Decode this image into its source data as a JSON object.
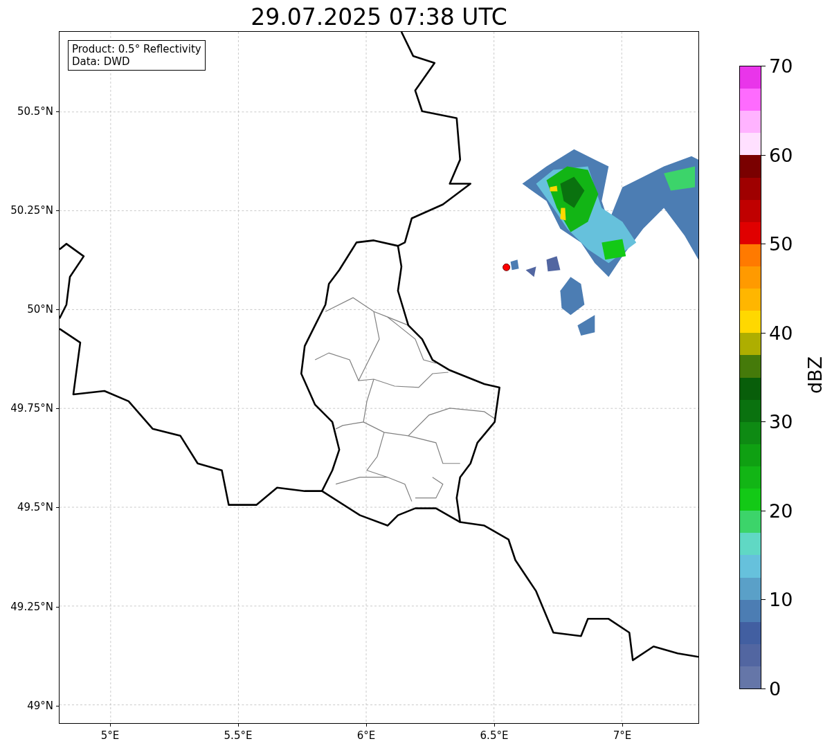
{
  "title": "29.07.2025 07:38 UTC",
  "legend": [
    "Product: 0.5° Reflectivity",
    "Data: DWD"
  ],
  "map": {
    "y_ticks": [
      "50.5°N",
      "50.25°N",
      "50°N",
      "49.75°N",
      "49.5°N",
      "49.25°N",
      "49°N"
    ],
    "x_ticks": [
      "5°E",
      "5.5°E",
      "6°E",
      "6.5°E",
      "7°E"
    ]
  },
  "colorbar": {
    "label": "dBZ",
    "ticks": [
      "70",
      "60",
      "50",
      "40",
      "30",
      "20",
      "10",
      "0"
    ],
    "bins": [
      {
        "color": "#e935ea"
      },
      {
        "color": "#fe6bfe"
      },
      {
        "color": "#ffb3ff"
      },
      {
        "color": "#ffe0ff"
      },
      {
        "color": "#7a0000"
      },
      {
        "color": "#9f0000"
      },
      {
        "color": "#c00000"
      },
      {
        "color": "#e00000"
      },
      {
        "color": "#ff7a00"
      },
      {
        "color": "#ff9a00"
      },
      {
        "color": "#ffb600"
      },
      {
        "color": "#ffd800"
      },
      {
        "color": "#aeae00"
      },
      {
        "color": "#457a0a"
      },
      {
        "color": "#085e0a"
      },
      {
        "color": "#0a720f"
      },
      {
        "color": "#0e8a13"
      },
      {
        "color": "#0fa012"
      },
      {
        "color": "#12b515"
      },
      {
        "color": "#13c916"
      },
      {
        "color": "#3cd46a"
      },
      {
        "color": "#60d8c4"
      },
      {
        "color": "#66c1dc"
      },
      {
        "color": "#5aa0c8"
      },
      {
        "color": "#4c7db3"
      },
      {
        "color": "#425fa1"
      },
      {
        "color": "#5266a1"
      },
      {
        "color": "#6576a8"
      }
    ]
  }
}
